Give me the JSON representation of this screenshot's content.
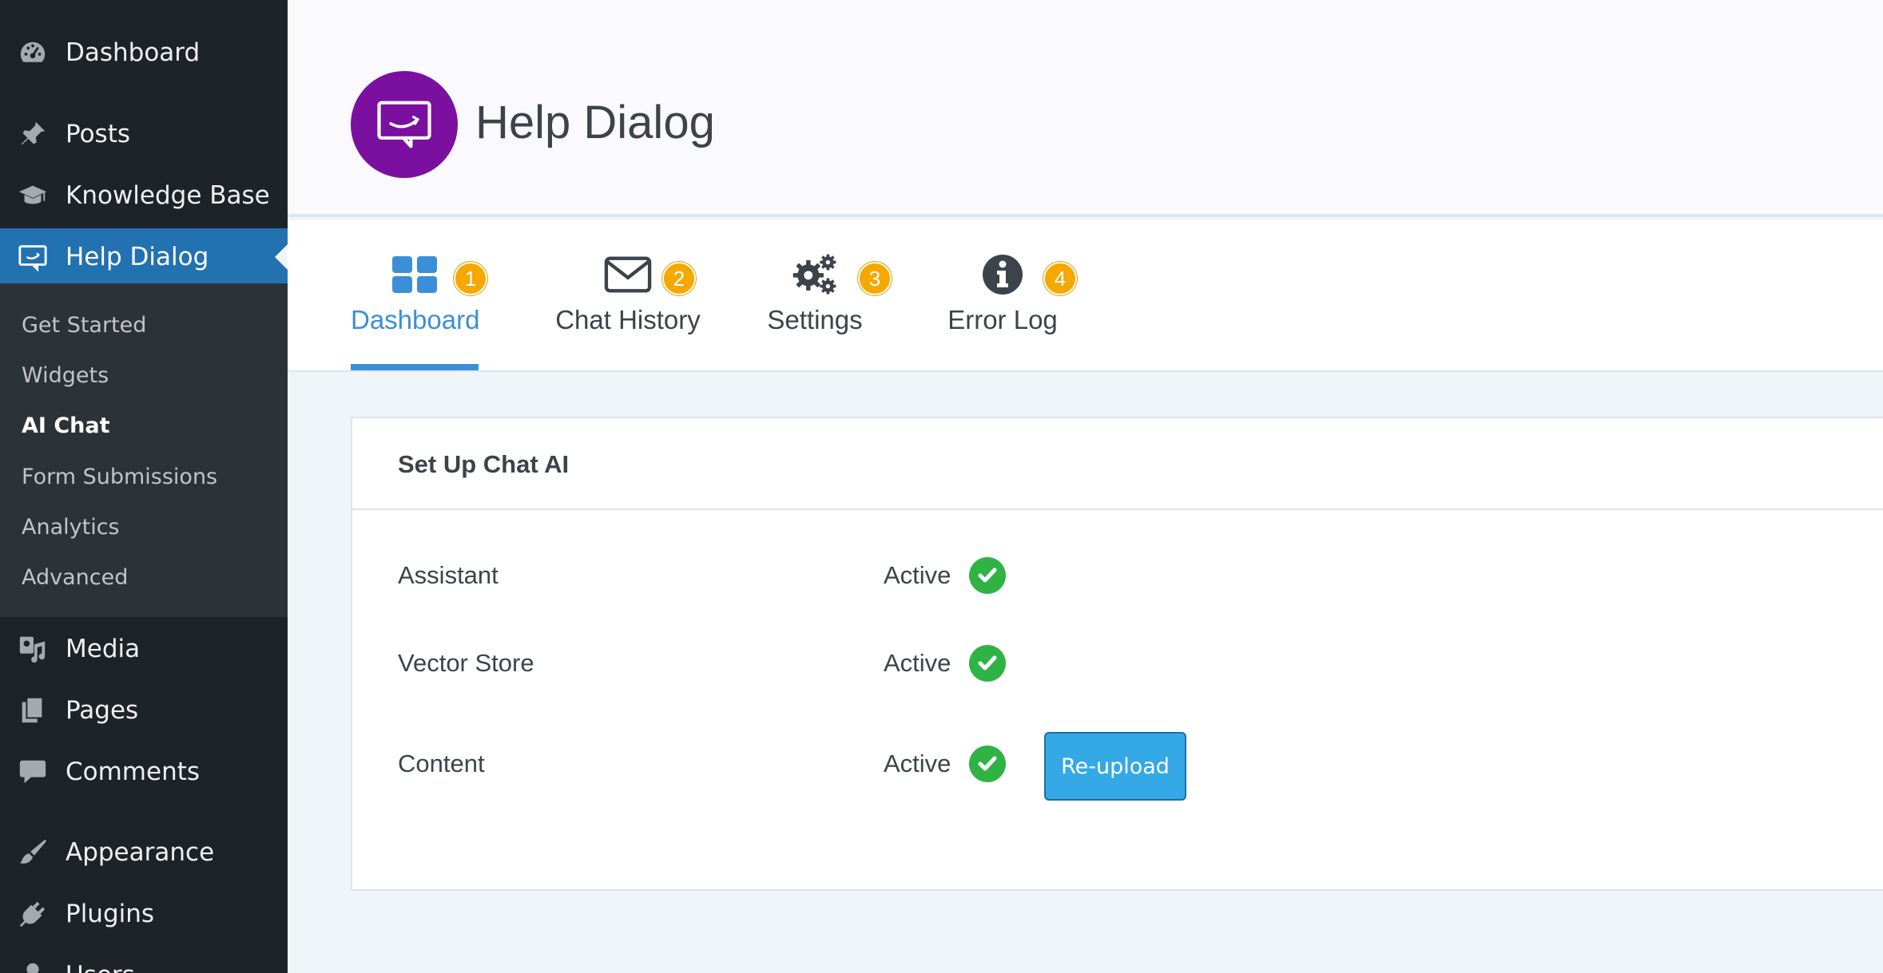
{
  "sidebar": {
    "top_items": [
      {
        "label": "Dashboard",
        "icon": "dashboard-icon"
      },
      {
        "label": "Posts",
        "icon": "pin-icon"
      },
      {
        "label": "Knowledge Base",
        "icon": "graduation-cap-icon"
      },
      {
        "label": "Help Dialog",
        "icon": "help-dialog-icon"
      }
    ],
    "sub_items": [
      {
        "label": "Get Started"
      },
      {
        "label": "Widgets"
      },
      {
        "label": "AI Chat"
      },
      {
        "label": "Form Submissions"
      },
      {
        "label": "Analytics"
      },
      {
        "label": "Advanced"
      }
    ],
    "bottom_items": [
      {
        "label": "Media",
        "icon": "media-icon"
      },
      {
        "label": "Pages",
        "icon": "pages-icon"
      },
      {
        "label": "Comments",
        "icon": "comment-icon"
      },
      {
        "label": "Appearance",
        "icon": "brush-icon"
      },
      {
        "label": "Plugins",
        "icon": "plug-icon"
      },
      {
        "label": "Users",
        "icon": "user-icon"
      }
    ],
    "active_item": "Help Dialog",
    "current_sub_item": "AI Chat"
  },
  "header": {
    "title": "Help Dialog",
    "logo_color": "#7b0fa0"
  },
  "tabs": [
    {
      "label": "Dashboard",
      "badge": "1",
      "icon": "grid-icon",
      "active": true
    },
    {
      "label": "Chat History",
      "badge": "2",
      "icon": "envelope-icon",
      "active": false
    },
    {
      "label": "Settings",
      "badge": "3",
      "icon": "gears-icon",
      "active": false
    },
    {
      "label": "Error Log",
      "badge": "4",
      "icon": "info-icon",
      "active": false
    }
  ],
  "card": {
    "title": "Set Up Chat AI",
    "rows": [
      {
        "label": "Assistant",
        "status": "Active"
      },
      {
        "label": "Vector Store",
        "status": "Active"
      },
      {
        "label": "Content",
        "status": "Active"
      }
    ],
    "reupload_label": "Re-upload"
  },
  "colors": {
    "sidebar_bg": "#1e2327",
    "submenu_bg": "#2c3338",
    "active_blue": "#2271b1",
    "tab_active": "#3b8fd8",
    "badge": "#f5a800",
    "check_green": "#2fb344",
    "button_blue": "#35a8e6"
  }
}
